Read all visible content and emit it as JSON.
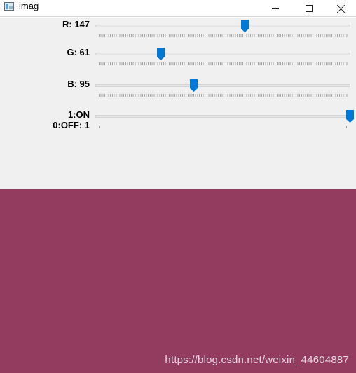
{
  "window": {
    "title": "imag"
  },
  "trackbars": [
    {
      "label": "R: 147",
      "value": 147,
      "max": 255
    },
    {
      "label": "G: 61",
      "value": 61,
      "max": 255
    },
    {
      "label": "B: 95",
      "value": 95,
      "max": 255
    },
    {
      "label_line1": "1:ON",
      "label_line2": "0:OFF: 1",
      "value": 1,
      "max": 1
    }
  ],
  "preview": {
    "color": "#933c5f"
  },
  "watermark": "https://blog.csdn.net/weixin_44604887",
  "colors": {
    "thumb": "#0078d7",
    "panel": "#f0f0f0"
  }
}
